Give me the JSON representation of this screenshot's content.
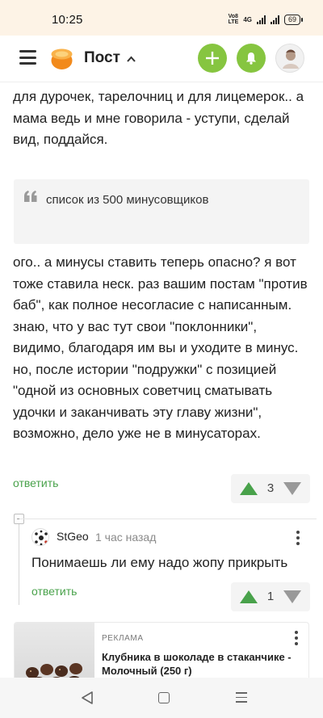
{
  "status_bar": {
    "time": "10:25",
    "volte_top": "Vo8",
    "volte_bottom": "LTE",
    "network": "4G",
    "battery": "69"
  },
  "header": {
    "title": "Пост",
    "accent_color": "#86c540"
  },
  "post": {
    "text_top": "для дурочек, тарелочниц и для лицемерок.. а мама ведь и мне говорила - уступи, сделай вид, поддайся.",
    "quote": "список из 500 минусовщиков",
    "text_main": "ого.. а минусы ставить теперь опасно? я вот тоже ставила неск. раз вашим постам \"против баб\", как полное несогласие с написанным. знаю, что у вас тут свои \"поклонники\", видимо, благодаря им вы и уходите в минус. но, после истории \"подружки\" с позицией \"одной из основных советчиц сматывать удочки и заканчивать эту главу жизни\", возможно, дело уже не в минусаторах.",
    "reply_label": "ответить",
    "rating": "3"
  },
  "comment": {
    "username": "StGeo",
    "time_ago": "1 час назад",
    "text": "Понимаешь ли ему надо жопу прикрыть",
    "reply_label": "ответить",
    "rating": "1"
  },
  "ad": {
    "label": "РЕКЛАМА",
    "title": "Клубника в шоколаде в стаканчике - Молочный (250 г)"
  }
}
